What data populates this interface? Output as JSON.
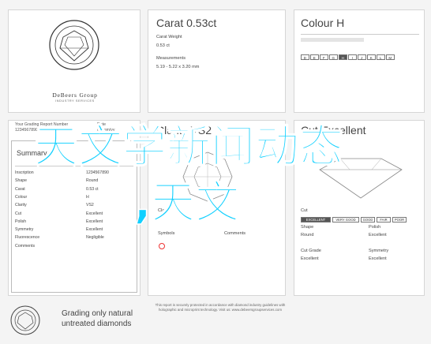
{
  "logo": {
    "seal_text": "INSTITUTE OF DIAMONDS",
    "brand": "DeBeers Group",
    "sub": "INDUSTRY SERVICES"
  },
  "report": {
    "grading_label": "Your Grading Report Number",
    "report_no": "1234567890",
    "date_label": "Date",
    "date": "dd/mm/yy"
  },
  "carat_panel": {
    "title": "Carat",
    "weight_head": "0.53ct",
    "weight_label": "Carat Weight",
    "weight_value": "0.53 ct",
    "measure_label": "Measurements",
    "measure_value": "5.19 - 5.22 x 3.20 mm"
  },
  "colour_panel": {
    "title": "Colour",
    "grade": "H",
    "scale": [
      "D",
      "E",
      "F",
      "G",
      "H",
      "I",
      "J",
      "K",
      "L",
      "M"
    ]
  },
  "summary": {
    "title": "Summary",
    "rows": [
      {
        "label": "Inscription",
        "value": "1234567890"
      },
      {
        "label": "Shape",
        "value": "Round"
      },
      {
        "label": "Carat",
        "value": "0.53 ct"
      },
      {
        "label": "Colour",
        "value": "H"
      },
      {
        "label": "Clarity",
        "value": "VS2"
      },
      {
        "label": "Cut",
        "value": "Excellent"
      },
      {
        "label": "Polish",
        "value": "Excellent"
      },
      {
        "label": "Symmetry",
        "value": "Excellent"
      },
      {
        "label": "Fluorescence",
        "value": "Negligible"
      },
      {
        "label": "Comments",
        "value": ""
      }
    ]
  },
  "clarity_panel": {
    "title": "Clarity",
    "grade": "VS2",
    "clarity_label": "Clarity",
    "symbols_label": "Symbols",
    "comments_label": "Comments"
  },
  "cut_panel": {
    "title": "Cut",
    "grade": "Excellent",
    "cut_label": "Cut",
    "scale": [
      "EXCELLENT",
      "VERY GOOD",
      "GOOD",
      "FAIR",
      "POOR"
    ],
    "shape_label": "Shape",
    "shape_value": "Round",
    "polish_label": "Polish",
    "polish_value": "Excellent",
    "cutgrade_label": "Cut Grade",
    "cutgrade_value": "Excellent",
    "symmetry_label": "Symmetry",
    "symmetry_value": "Excellent"
  },
  "footer": {
    "line1": "Grading only natural",
    "line2": "untreated diamonds",
    "notice": "This report is securely protected in accordance with diamond industry guidelines with holographic and microprint technology. Visit us: www.debeersgroupservices.com"
  },
  "overlay": {
    "line1": "天文学新闻动态",
    "line2": ",天文"
  },
  "colors": {
    "overlay": "#11d0ff",
    "panel_border": "#d6d6d6",
    "background": "#f4f4f4"
  }
}
